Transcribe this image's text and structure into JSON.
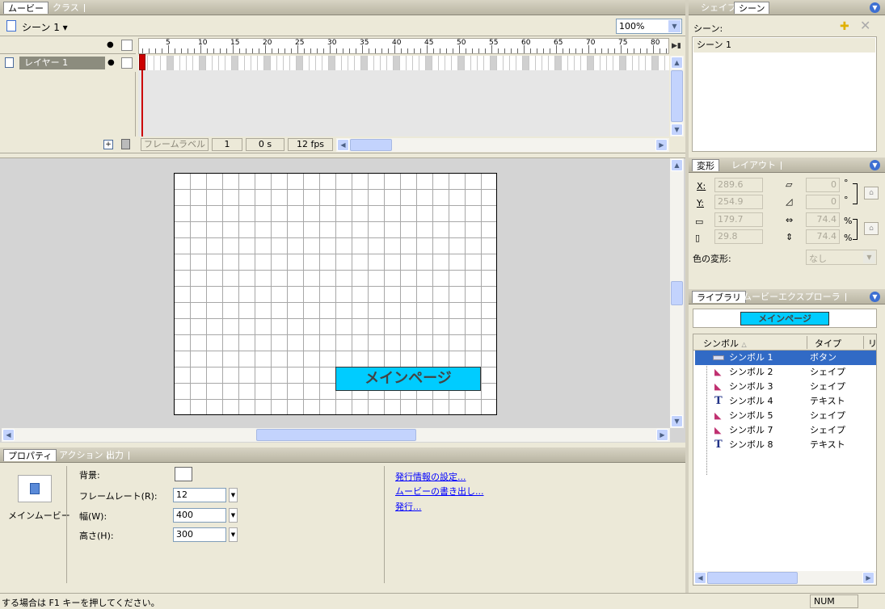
{
  "movie_tabs": {
    "movie": "ムービー",
    "class": "クラス"
  },
  "scene_bar": {
    "scene_label": "シーン 1",
    "zoom": "100%"
  },
  "timeline": {
    "ruler_ticks": [
      "5",
      "10",
      "15",
      "20",
      "25",
      "30",
      "35",
      "40",
      "45",
      "50",
      "55",
      "60",
      "65",
      "70",
      "75",
      "80"
    ],
    "layer_name": "レイヤー 1",
    "frame_label": "フレームラベル",
    "current_frame": "1",
    "elapsed": "0 s",
    "fps": "12 fps"
  },
  "stage": {
    "button_text": "メインページ"
  },
  "properties": {
    "tabs": {
      "properties": "プロパティ",
      "actions": "アクション",
      "output": "出力"
    },
    "icon_label": "メインムービー",
    "background_label": "背景:",
    "framerate_label": "フレームレート(R):",
    "framerate_value": "12",
    "width_label": "幅(W):",
    "width_value": "400",
    "height_label": "高さ(H):",
    "height_value": "300",
    "links": {
      "publish_settings": "発行情報の設定...",
      "export_movie": "ムービーの書き出し...",
      "publish": "発行..."
    }
  },
  "status_bar": {
    "help_text": "する場合は F1 キーを押してください。",
    "num": "NUM"
  },
  "scene_panel": {
    "tabs": {
      "shape": "シェイプ",
      "scene": "シーン"
    },
    "heading": "シーン:",
    "items": [
      "シーン 1"
    ]
  },
  "transform_panel": {
    "tabs": {
      "transform": "変形",
      "layout": "レイアウト"
    },
    "x_label": "X:",
    "x_value": "289.6",
    "y_label": "Y:",
    "y_value": "254.9",
    "w_value": "179.7",
    "h_value": "29.8",
    "skew_h_value": "0",
    "skew_v_value": "0",
    "scale_w_value": "74.4",
    "scale_h_value": "74.4",
    "degree": "°",
    "percent": "%",
    "color_label": "色の変形:",
    "color_value": "なし"
  },
  "library_panel": {
    "tabs": {
      "library": "ライブラリ",
      "explorer": "ムービーエクスプローラ"
    },
    "preview_text": "メインページ",
    "col_symbol": "シンボル",
    "col_type": "タイプ",
    "col_extra": "リ",
    "items": [
      {
        "name": "シンボル 1",
        "type": "ボタン"
      },
      {
        "name": "シンボル 2",
        "type": "シェイプ"
      },
      {
        "name": "シンボル 3",
        "type": "シェイプ"
      },
      {
        "name": "シンボル 4",
        "type": "テキスト"
      },
      {
        "name": "シンボル 5",
        "type": "シェイプ"
      },
      {
        "name": "シンボル 7",
        "type": "シェイプ"
      },
      {
        "name": "シンボル 8",
        "type": "テキスト"
      }
    ]
  },
  "colors": {
    "accent": "#316ac5",
    "button_fill": "#00ccff",
    "playhead": "#cc0000"
  }
}
